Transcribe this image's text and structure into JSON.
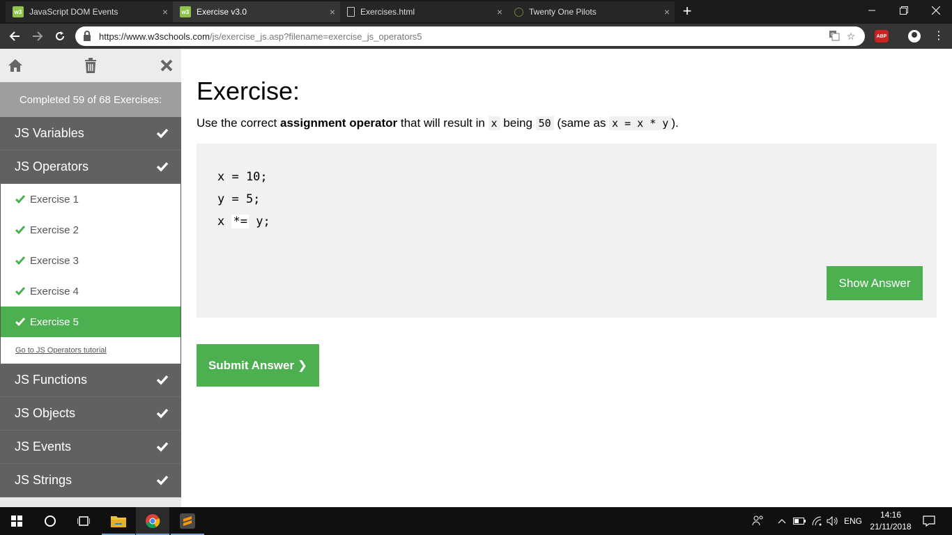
{
  "browser": {
    "tabs": [
      {
        "title": "JavaScript DOM Events",
        "favicon": "w3schools-icon",
        "active": false
      },
      {
        "title": "Exercise v3.0",
        "favicon": "w3schools-icon",
        "active": true
      },
      {
        "title": "Exercises.html",
        "favicon": "document-icon",
        "active": false
      },
      {
        "title": "Twenty One Pilots",
        "favicon": "music-icon",
        "active": false
      }
    ],
    "tab_close_glyph": "×",
    "new_tab_glyph": "+",
    "url_host": "https://www.w3schools.com",
    "url_path": "/js/exercise_js.asp?filename=exercise_js_operators5",
    "adblock_label": "ABP"
  },
  "sidebar": {
    "progress_text": "Completed 59 of 68 Exercises:",
    "categories_before": [
      {
        "label": "JS Variables",
        "completed": true
      },
      {
        "label": "JS Operators",
        "completed": true
      }
    ],
    "exercises": [
      {
        "label": "Exercise 1",
        "completed": true,
        "active": false
      },
      {
        "label": "Exercise 2",
        "completed": true,
        "active": false
      },
      {
        "label": "Exercise 3",
        "completed": true,
        "active": false
      },
      {
        "label": "Exercise 4",
        "completed": true,
        "active": false
      },
      {
        "label": "Exercise 5",
        "completed": true,
        "active": true
      }
    ],
    "tutorial_link": "Go to JS Operators tutorial",
    "categories_after": [
      {
        "label": "JS Functions",
        "completed": true
      },
      {
        "label": "JS Objects",
        "completed": true
      },
      {
        "label": "JS Events",
        "completed": true
      },
      {
        "label": "JS Strings",
        "completed": true
      }
    ]
  },
  "main": {
    "heading": "Exercise:",
    "instruction": {
      "part1": "Use the correct ",
      "bold": "assignment operator",
      "part2": " that will result in ",
      "code1": "x",
      "part3": " being ",
      "code2": "50",
      "part4": " (same as ",
      "code3": "x = x * y",
      "part5": ")."
    },
    "code_lines": {
      "line1": "x = 10;",
      "line2": "y = 5;",
      "line3_prefix": "x ",
      "line3_answer": "*=",
      "line3_suffix": " y;"
    },
    "show_answer_label": "Show Answer",
    "submit_label": "Submit Answer ❯"
  },
  "taskbar": {
    "language": "ENG",
    "time": "14:16",
    "date": "21/11/2018"
  },
  "colors": {
    "accent_green": "#4caf50",
    "sidebar_dark": "#616161",
    "banner_grey": "#9e9e9e",
    "code_bg": "#f1f1f1"
  }
}
